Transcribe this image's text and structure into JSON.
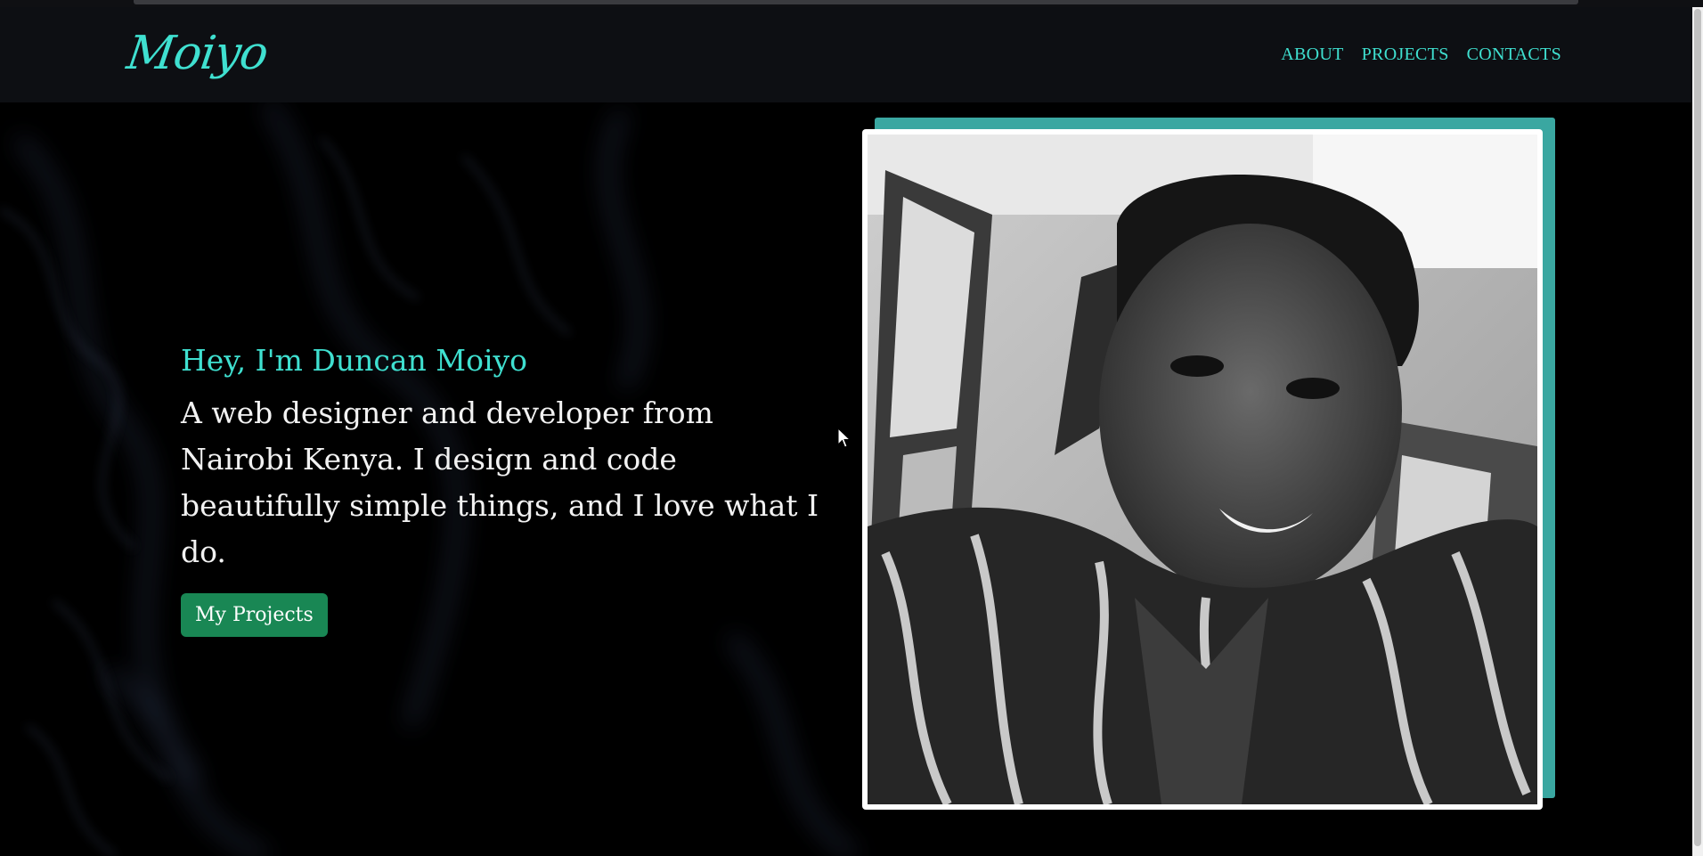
{
  "brand": {
    "logo_text": "Moiyo"
  },
  "nav": {
    "items": [
      {
        "label": "ABOUT"
      },
      {
        "label": "PROJECTS"
      },
      {
        "label": "CONTACTS"
      }
    ]
  },
  "hero": {
    "greeting": "Hey, I'm Duncan Moiyo",
    "tagline": "A web designer and developer from Nairobi Kenya. I design and code beautifully simple things, and I love what I do.",
    "cta_label": "My Projects"
  },
  "colors": {
    "accent": "#3fe0d0",
    "frame_accent": "#3aa7a1",
    "button": "#198754",
    "background": "#000000"
  },
  "icons": {
    "cursor": "mouse-pointer-icon"
  }
}
